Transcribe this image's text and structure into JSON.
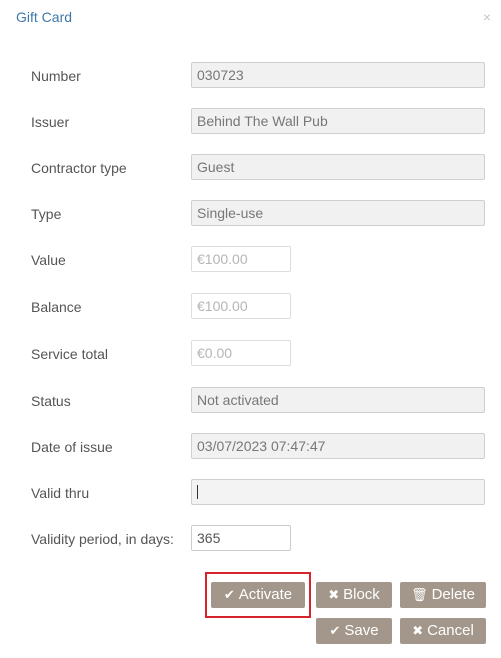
{
  "dialog": {
    "title": "Gift Card",
    "close_glyph": "×"
  },
  "fields": {
    "number": {
      "label": "Number",
      "value": "030723"
    },
    "issuer": {
      "label": "Issuer",
      "value": "Behind The Wall Pub"
    },
    "contractor": {
      "label": "Contractor type",
      "value": "Guest"
    },
    "type": {
      "label": "Type",
      "value": "Single-use"
    },
    "value": {
      "label": "Value",
      "value": "€100.00"
    },
    "balance": {
      "label": "Balance",
      "value": "€100.00"
    },
    "service_total": {
      "label": "Service total",
      "value": "€0.00"
    },
    "status": {
      "label": "Status",
      "value": "Not activated"
    },
    "date_of_issue": {
      "label": "Date of issue",
      "value": "03/07/2023 07:47:47"
    },
    "valid_thru": {
      "label": "Valid thru",
      "value": ""
    },
    "validity": {
      "label": "Validity period, in days:",
      "value": "365"
    }
  },
  "actions": {
    "activate": {
      "icon": "check-icon",
      "glyph": "✔",
      "label": "Activate"
    },
    "block": {
      "icon": "x-icon",
      "glyph": "✖",
      "label": "Block"
    },
    "delete": {
      "icon": "trash-icon",
      "glyph": "🗑",
      "label": "Delete"
    },
    "save": {
      "icon": "check-icon",
      "glyph": "✔",
      "label": "Save"
    },
    "cancel": {
      "icon": "x-icon",
      "glyph": "✖",
      "label": "Cancel"
    }
  },
  "colors": {
    "title": "#3f78a8",
    "button": "#a2978a",
    "highlight": "#d6232c"
  }
}
